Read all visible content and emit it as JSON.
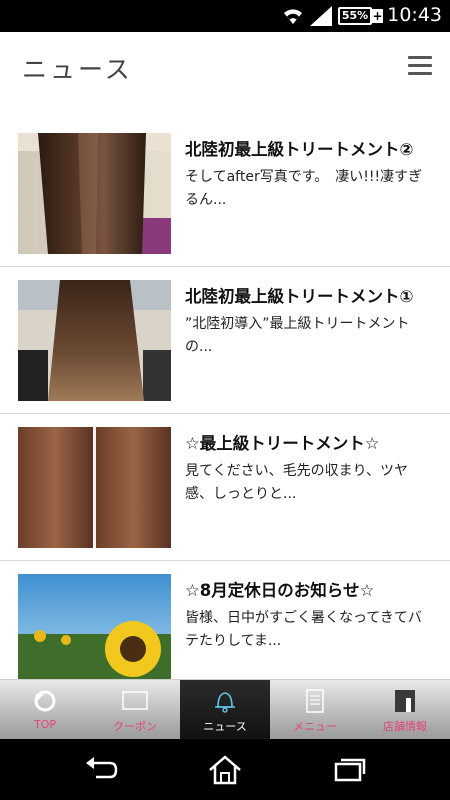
{
  "status_bar": {
    "time": "10:43",
    "battery": "55%",
    "battery_plus": "+",
    "icons": [
      "wifi-icon",
      "signal-icon",
      "battery-icon"
    ]
  },
  "header": {
    "title": "ニュース",
    "menu_icon": "hamburger-menu-icon"
  },
  "news": [
    {
      "title": "北陸初最上級トリートメント②",
      "desc": "そしてafter写真です。　凄い!!!凄すぎるん...",
      "thumb": "hair-after-photo"
    },
    {
      "title": "北陸初最上級トリートメント①",
      "desc": "”北陸初導入”最上級トリートメントの...",
      "thumb": "hair-before-photo"
    },
    {
      "title": "☆最上級トリートメント☆",
      "desc": "見てください、毛先の収まり、ツヤ感、しっとりと...",
      "thumb": "hair-comparison-photo"
    },
    {
      "title": "☆8月定休日のお知らせ☆",
      "desc": "皆様、日中がすごく暑くなってきてバテたりしてま...",
      "thumb": "sunflower-photo"
    }
  ],
  "tabs": [
    {
      "label": "TOP",
      "icon": "top-icon",
      "active": false
    },
    {
      "label": "クーポン",
      "icon": "coupon-icon",
      "active": false
    },
    {
      "label": "ニュース",
      "icon": "bell-icon",
      "active": true
    },
    {
      "label": "メニュー",
      "icon": "menu-doc-icon",
      "active": false
    },
    {
      "label": "店舗情報",
      "icon": "shop-icon",
      "active": false
    }
  ],
  "nav": [
    "back-icon",
    "home-icon",
    "recent-apps-icon"
  ],
  "colors": {
    "tab_label": "#e0457b",
    "tab_active_bg": "#111111",
    "title_text": "#444444"
  }
}
